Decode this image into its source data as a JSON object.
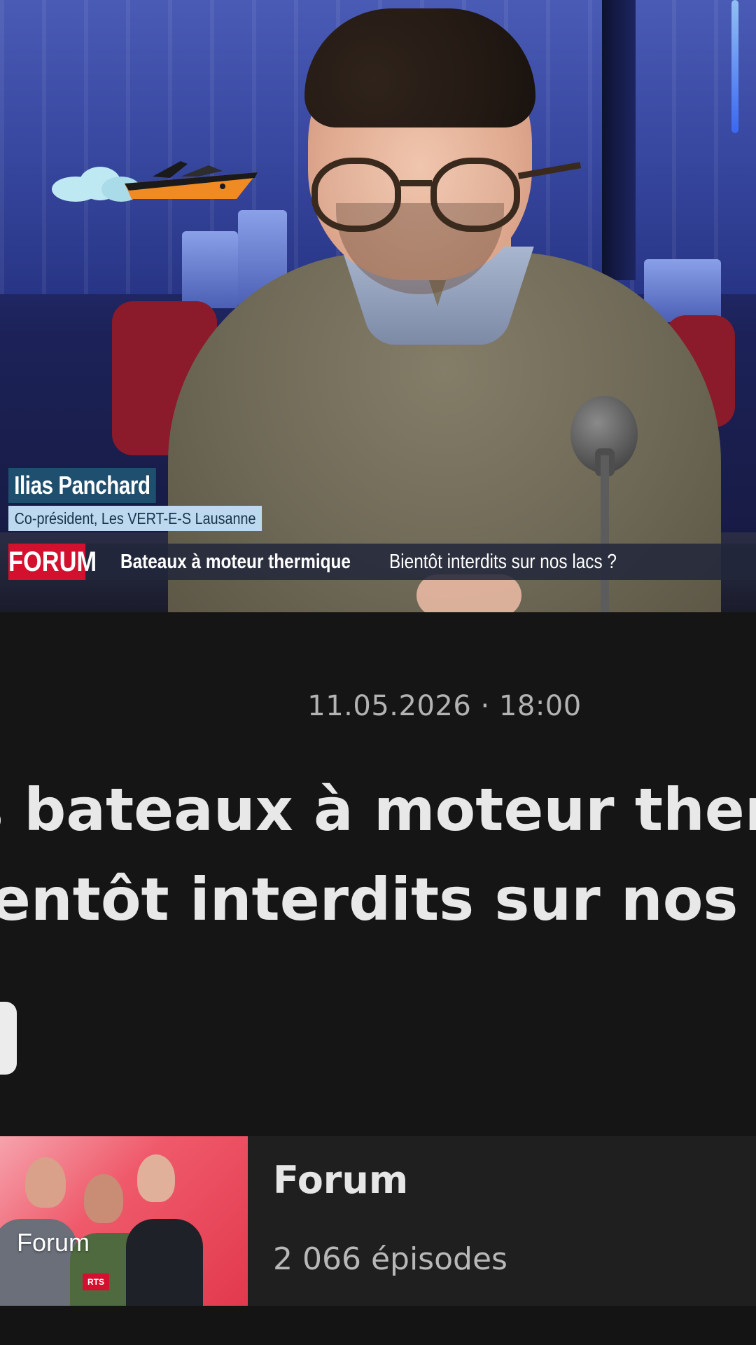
{
  "video": {
    "lower_third": {
      "name": "Ilias Panchard",
      "role": "Co-président, Les VERT-E-S Lausanne",
      "show_badge": "FORUM",
      "topic": "Bateaux à moteur thermique",
      "question": "Bientôt interdits sur nos lacs ?"
    }
  },
  "episode": {
    "datetime": "11.05.2026 · 18:00",
    "title_line1": "es bateaux à moteur therm",
    "title_line2": "pientôt interdits sur nos la"
  },
  "show": {
    "thumbnail_label": "Forum",
    "thumbnail_logo": "RTS",
    "name": "Forum",
    "episodes": "2 066 épisodes"
  },
  "colors": {
    "background": "#151515",
    "forum_red": "#d3102e",
    "card_background": "#1f1f1f"
  }
}
